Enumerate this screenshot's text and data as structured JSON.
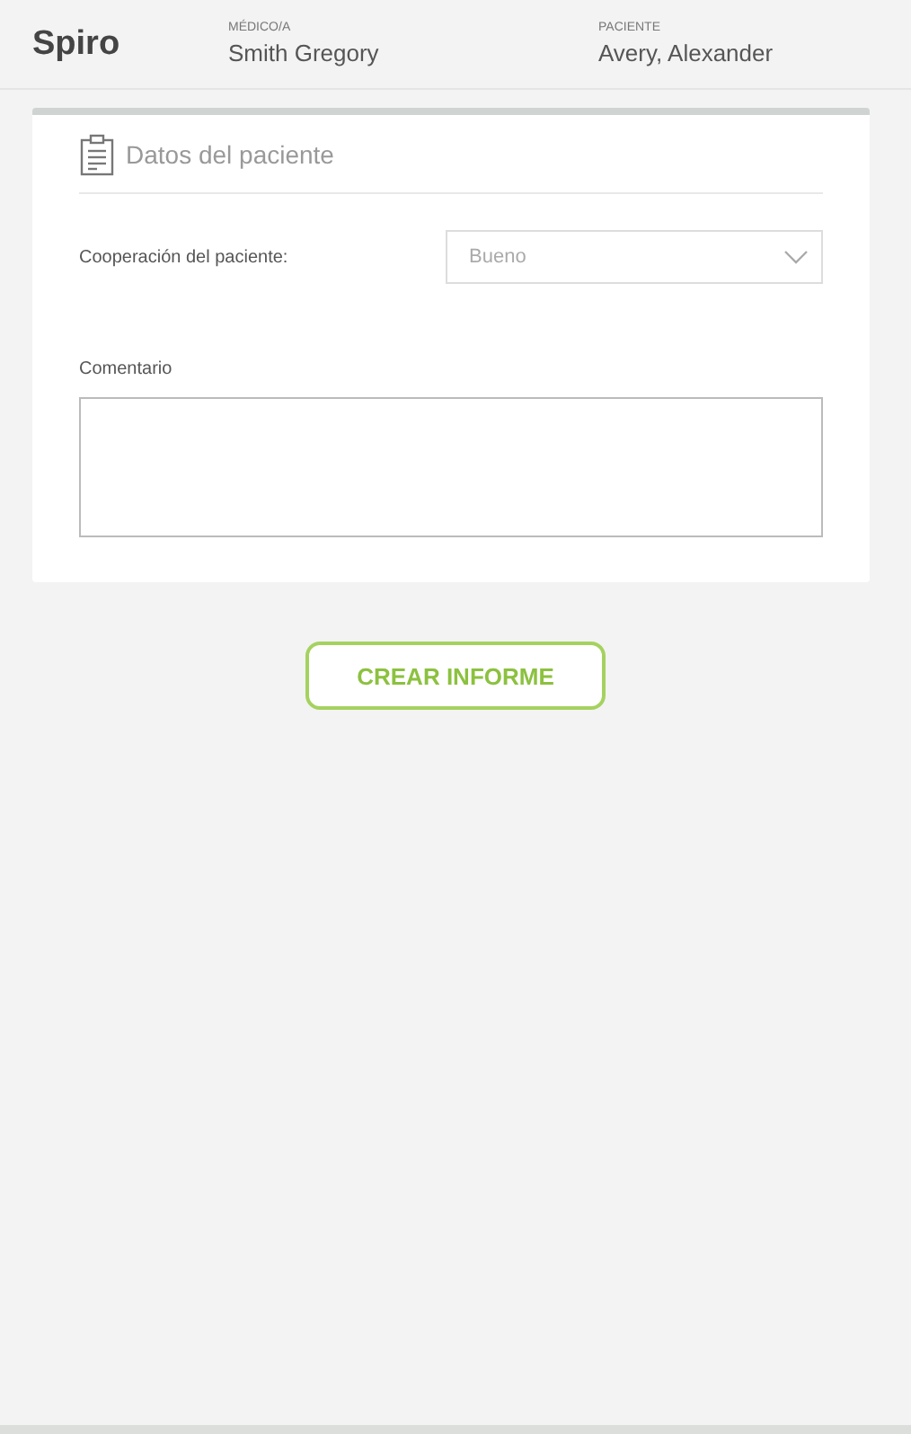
{
  "header": {
    "app_name": "Spiro",
    "fields": [
      {
        "label": "MÉDICO/A",
        "value": "Smith Gregory"
      },
      {
        "label": "PACIENTE",
        "value": "Avery, Alexander"
      }
    ]
  },
  "card": {
    "title": "Datos del paciente",
    "cooperation": {
      "label": "Cooperación del paciente:",
      "value": "Bueno"
    },
    "comment": {
      "label": "Comentario"
    }
  },
  "create_button": "CREAR INFORME"
}
